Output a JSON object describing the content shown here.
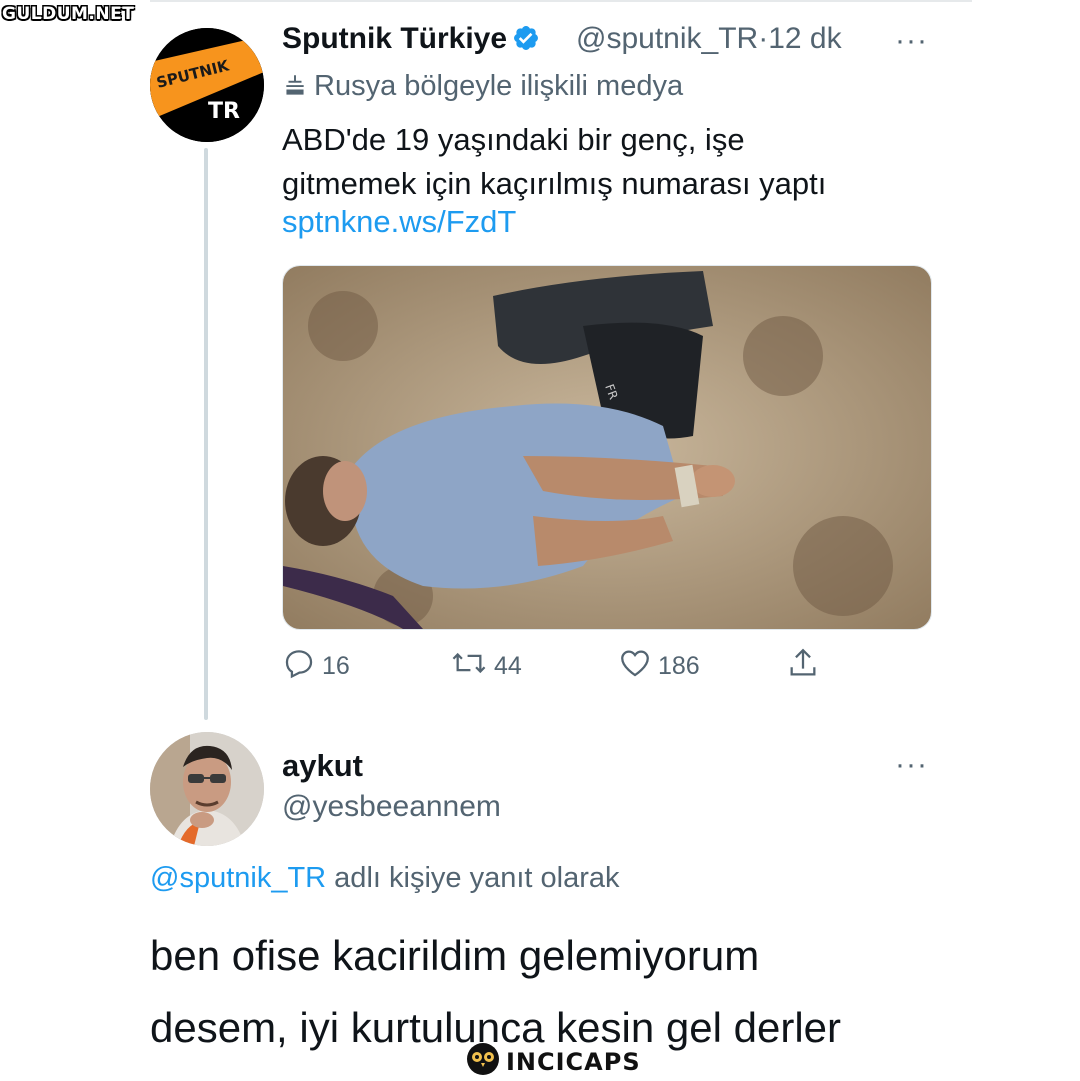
{
  "watermark_top": "GULDUM.NET",
  "tweet": {
    "avatar_text_top": "SPUTNIK",
    "avatar_text_bottom": "TR",
    "display_name": "Sputnik Türkiye",
    "handle": "@sputnik_TR",
    "separator": "·",
    "time": "12 dk",
    "label": "Rusya bölgeyle ilişkili medya",
    "text_line1": "ABD'de 19 yaşındaki bir genç, işe",
    "text_line2": "gitmemek için kaçırılmış numarası yaptı",
    "link": "sptnkne.ws/FzdT",
    "reply_count": "16",
    "retweet_count": "44",
    "like_count": "186",
    "more": "···",
    "image_overlay_text": "FR"
  },
  "reply": {
    "display_name": "aykut",
    "handle": "@yesbeeannem",
    "more": "···",
    "replying_to_mention": "@sputnik_TR",
    "replying_to_suffix": " adlı kişiye yanıt olarak",
    "text_line1": "ben ofise kacirildim gelemiyorum",
    "text_line2": "desem, iyi kurtulunca kesin gel derler"
  },
  "watermark_bottom": "INCICAPS",
  "colors": {
    "text": "#0f1419",
    "secondary": "#536471",
    "link": "#1d9bf0",
    "verified": "#1d9bf0",
    "thread_line": "#cfd9de",
    "sputnik_orange": "#f7941d"
  }
}
